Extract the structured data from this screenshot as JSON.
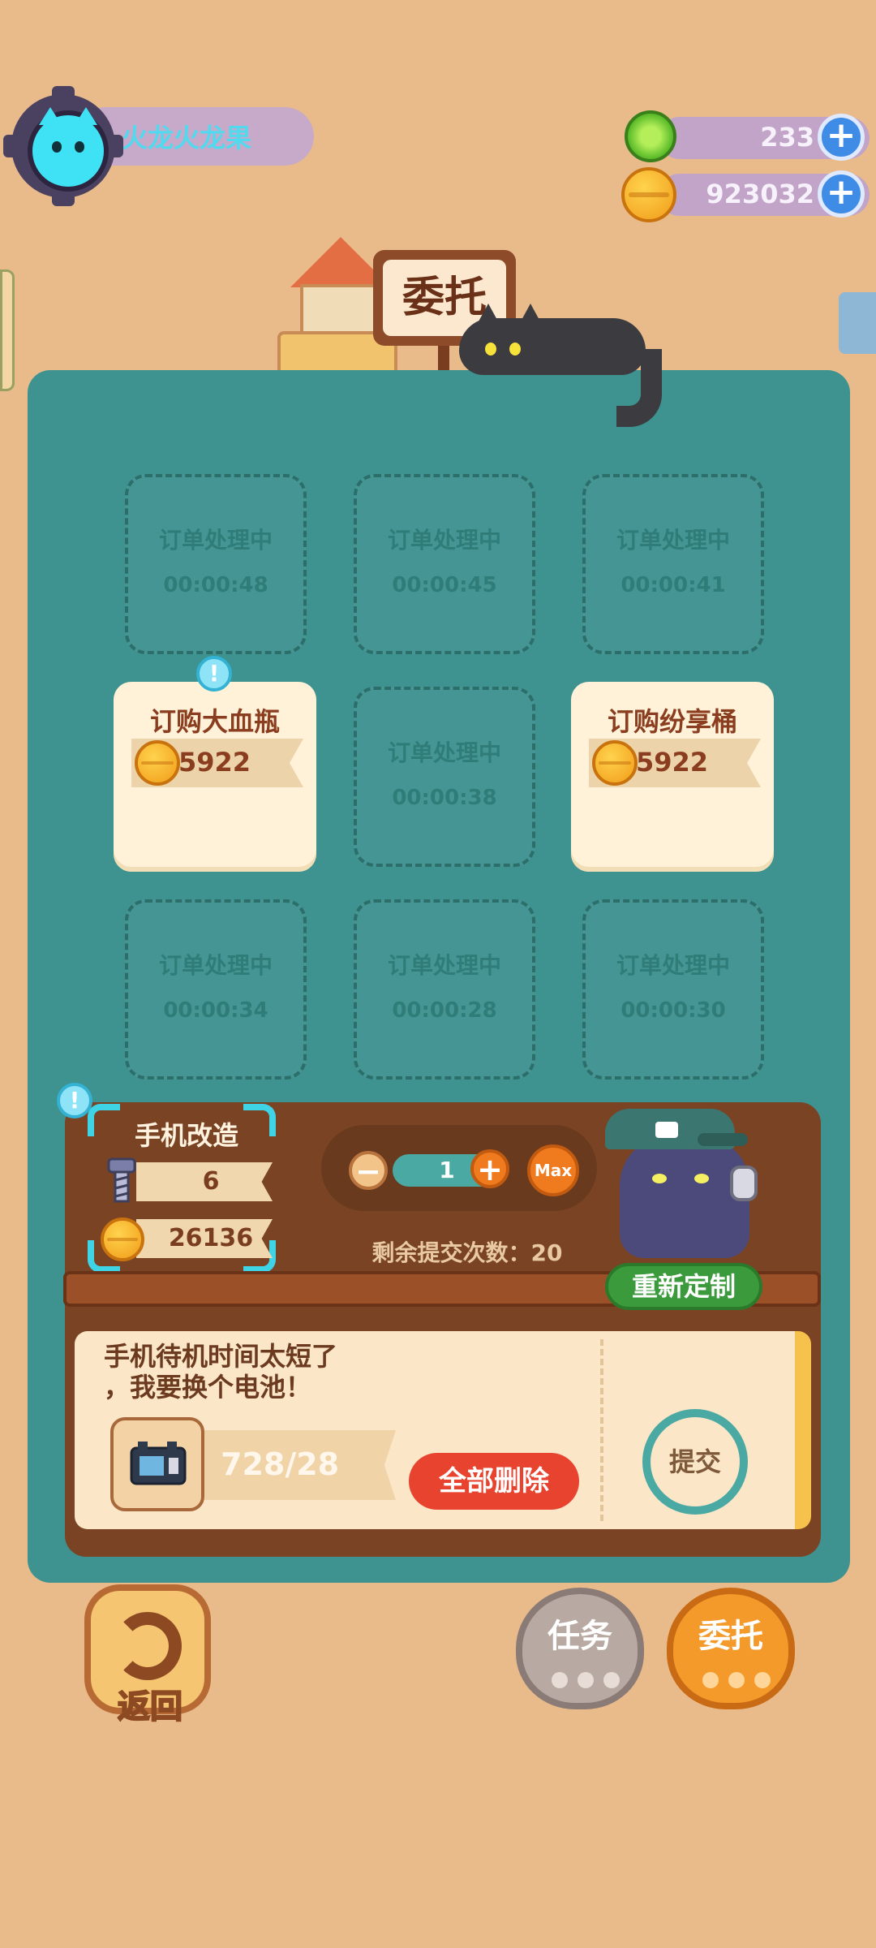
{
  "player": {
    "name": "火龙火龙果"
  },
  "currencies": [
    {
      "icon": "green-gem-icon",
      "value": "233"
    },
    {
      "icon": "gold-coin-icon",
      "value": "923032"
    }
  ],
  "header": {
    "sign_title": "委托"
  },
  "orders": [
    {
      "state": "processing",
      "title": "订单处理中",
      "time": "00:00:48"
    },
    {
      "state": "processing",
      "title": "订单处理中",
      "time": "00:00:45"
    },
    {
      "state": "processing",
      "title": "订单处理中",
      "time": "00:00:41"
    },
    {
      "state": "available",
      "title": "订购大血瓶",
      "reward": "5922"
    },
    {
      "state": "processing",
      "title": "订单处理中",
      "time": "00:00:38"
    },
    {
      "state": "available",
      "title": "订购纷享桶",
      "reward": "5922"
    },
    {
      "state": "processing",
      "title": "订单处理中",
      "time": "00:00:34"
    },
    {
      "state": "processing",
      "title": "订单处理中",
      "time": "00:00:28"
    },
    {
      "state": "processing",
      "title": "订单处理中",
      "time": "00:00:30"
    }
  ],
  "detail": {
    "task_name": "手机改造",
    "bolt_reward": "6",
    "coin_reward": "26136",
    "quantity": "1",
    "max_label": "Max",
    "remaining_label": "剩余提交次数：20",
    "regenerate_label": "重新定制",
    "request_text": "手机待机时间太短了\n，我要换个电池！",
    "item_progress": "728/28",
    "delete_all_label": "全部删除",
    "submit_label": "提交"
  },
  "bottom_nav": {
    "back_label": "返回",
    "tasks_label": "任务",
    "commission_label": "委托"
  },
  "colors": {
    "background": "#e9bb8b",
    "panel": "#3e9290",
    "delete_button": "#e8432f",
    "regenerate_button": "#3b9a3b",
    "player_name": "#53d9ee"
  }
}
